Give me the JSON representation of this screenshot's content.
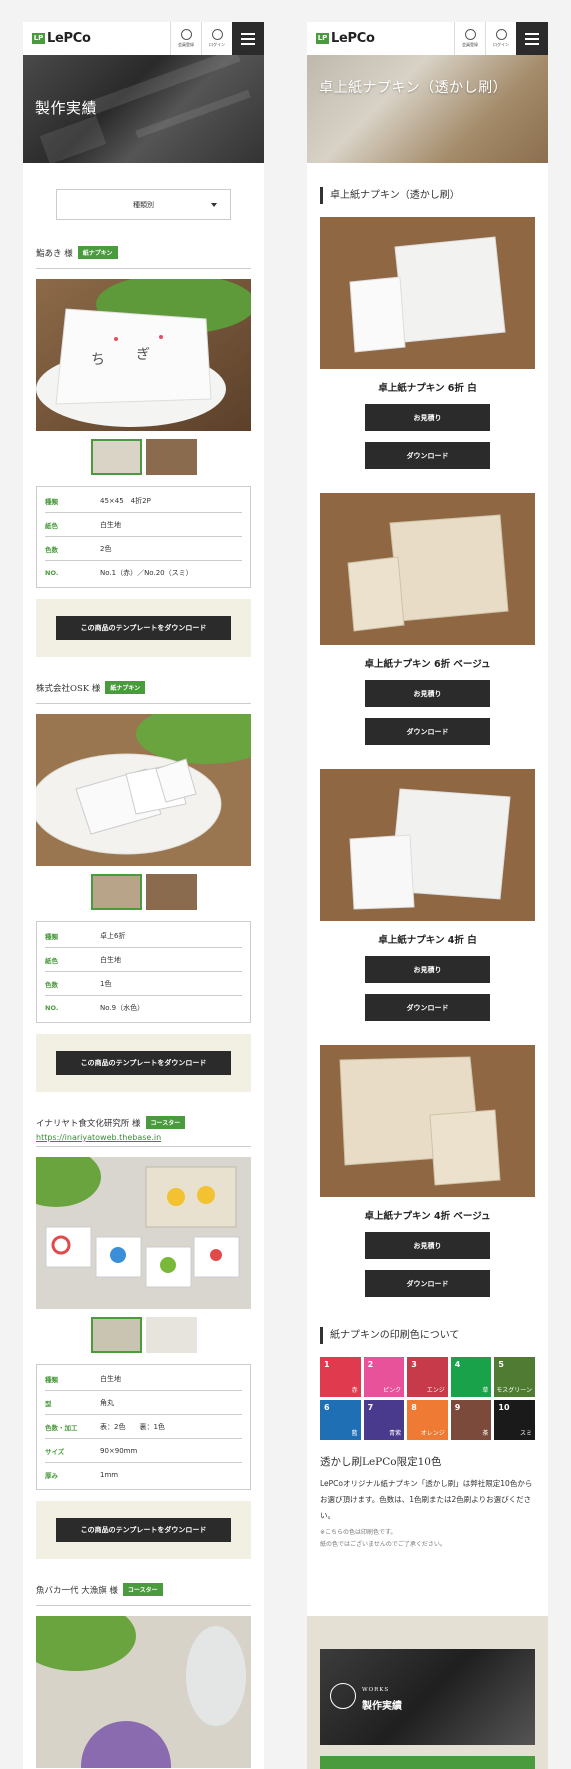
{
  "header": {
    "logo_mark": "LP",
    "logo_text": "LePCo",
    "register_label": "会員登録",
    "login_label": "ログイン",
    "menu_icon": "hamburger-icon",
    "register_icon": "user-icon",
    "login_icon": "login-arrow-icon"
  },
  "left": {
    "hero_title": "製作実績",
    "filter_select": "種類別",
    "download_label": "この商品のテンプレートをダウンロード",
    "works": [
      {
        "title": "鮨あき 様",
        "badge": "紙ナプキン",
        "specs": [
          {
            "k": "種類",
            "v": "45×45　4折2P"
          },
          {
            "k": "紙色",
            "v": "白生地"
          },
          {
            "k": "色数",
            "v": "2色"
          },
          {
            "k": "NO.",
            "v": "No.1（赤）／No.20（スミ）"
          }
        ]
      },
      {
        "title": "株式会社OSK 様",
        "badge": "紙ナプキン",
        "specs": [
          {
            "k": "種類",
            "v": "卓上6折"
          },
          {
            "k": "紙色",
            "v": "白生地"
          },
          {
            "k": "色数",
            "v": "1色"
          },
          {
            "k": "NO.",
            "v": "No.9（水色）"
          }
        ]
      },
      {
        "title": "イナリヤト食文化研究所 様",
        "badge": "コースター",
        "url": "https://inariyatoweb.thebase.in",
        "specs": [
          {
            "k": "種類",
            "v": "白生地"
          },
          {
            "k": "型",
            "v": "角丸"
          },
          {
            "k": "色数・加工",
            "v": "表：2色　　裏：1色"
          },
          {
            "k": "サイズ",
            "v": "90×90mm"
          },
          {
            "k": "厚み",
            "v": "1mm"
          }
        ]
      },
      {
        "title": "魚バカ一代 大漁旗 様",
        "badge": "コースター"
      }
    ]
  },
  "right": {
    "hero_title": "卓上紙ナプキン（透かし刷）",
    "section_title": "卓上紙ナプキン（透かし刷）",
    "estimate_label": "お見積り",
    "download_label": "ダウンロード",
    "products": [
      {
        "name": "卓上紙ナプキン 6折 白"
      },
      {
        "name": "卓上紙ナプキン 6折 ベージュ"
      },
      {
        "name": "卓上紙ナプキン 4折 白"
      },
      {
        "name": "卓上紙ナプキン 4折 ベージュ"
      }
    ],
    "colors_title": "紙ナプキンの印刷色について",
    "colors": [
      {
        "n": "1",
        "c": "赤",
        "hex": "#e03a4e"
      },
      {
        "n": "2",
        "c": "ピンク",
        "hex": "#e8529a"
      },
      {
        "n": "3",
        "c": "エンジ",
        "hex": "#c63a4a"
      },
      {
        "n": "4",
        "c": "草",
        "hex": "#1aa24a"
      },
      {
        "n": "5",
        "c": "モスグリーン",
        "hex": "#4f7b32"
      },
      {
        "n": "6",
        "c": "藍",
        "hex": "#1f6fb5"
      },
      {
        "n": "7",
        "c": "青紫",
        "hex": "#4a3a8e"
      },
      {
        "n": "8",
        "c": "オレンジ",
        "hex": "#ee7a33"
      },
      {
        "n": "9",
        "c": "茶",
        "hex": "#7b4a3a"
      },
      {
        "n": "10",
        "c": "スミ",
        "hex": "#1a1a1a"
      }
    ],
    "limited_title": "透かし刷LePCo限定10色",
    "limited_desc": "LePCoオリジナル紙ナプキン「透かし刷」は弊社限定10色からお選び頂けます。色数は、1色刷または2色刷よりお選びください。",
    "note1": "※こちらの色は印刷色です。",
    "note2": "紙の色ではございませんのでご了承ください。",
    "works_en": "WORKS",
    "works_ja": "製作実績"
  },
  "colors": {
    "accent": "#4a9a3e",
    "dark": "#2b2b2b",
    "beige": "#f2efe3"
  }
}
